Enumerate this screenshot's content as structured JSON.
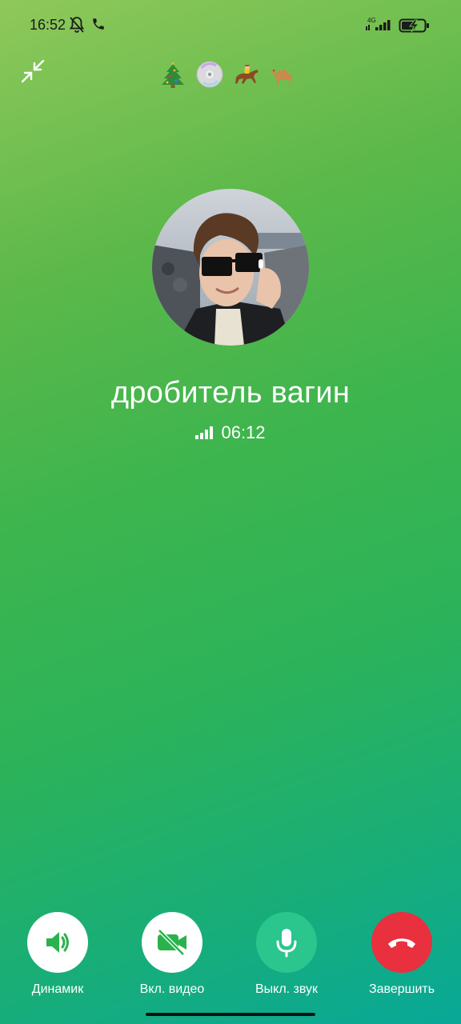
{
  "status_bar": {
    "time": "16:52",
    "network": "4G",
    "icons": [
      "bell-off-icon",
      "phone-icon",
      "signal-icon",
      "battery-charging-icon"
    ]
  },
  "header": {
    "minimize_icon": "minimize-arrows-icon",
    "encryption_emojis": [
      "christmas-tree",
      "dvd",
      "horse-racing",
      "camel"
    ]
  },
  "call": {
    "contact_name": "дробитель вагин",
    "duration": "06:12",
    "quality_icon": "signal-bars-icon"
  },
  "controls": [
    {
      "label": "Динамик",
      "icon": "speaker-icon"
    },
    {
      "label": "Вкл. видео",
      "icon": "video-off-icon"
    },
    {
      "label": "Выкл. звук",
      "icon": "microphone-icon"
    },
    {
      "label": "Завершить",
      "icon": "end-call-icon"
    }
  ],
  "colors": {
    "end_call": "#e8303e",
    "mute_button": "#2bc58e",
    "background_top": "#8fc85a",
    "background_bottom": "#08a898"
  }
}
